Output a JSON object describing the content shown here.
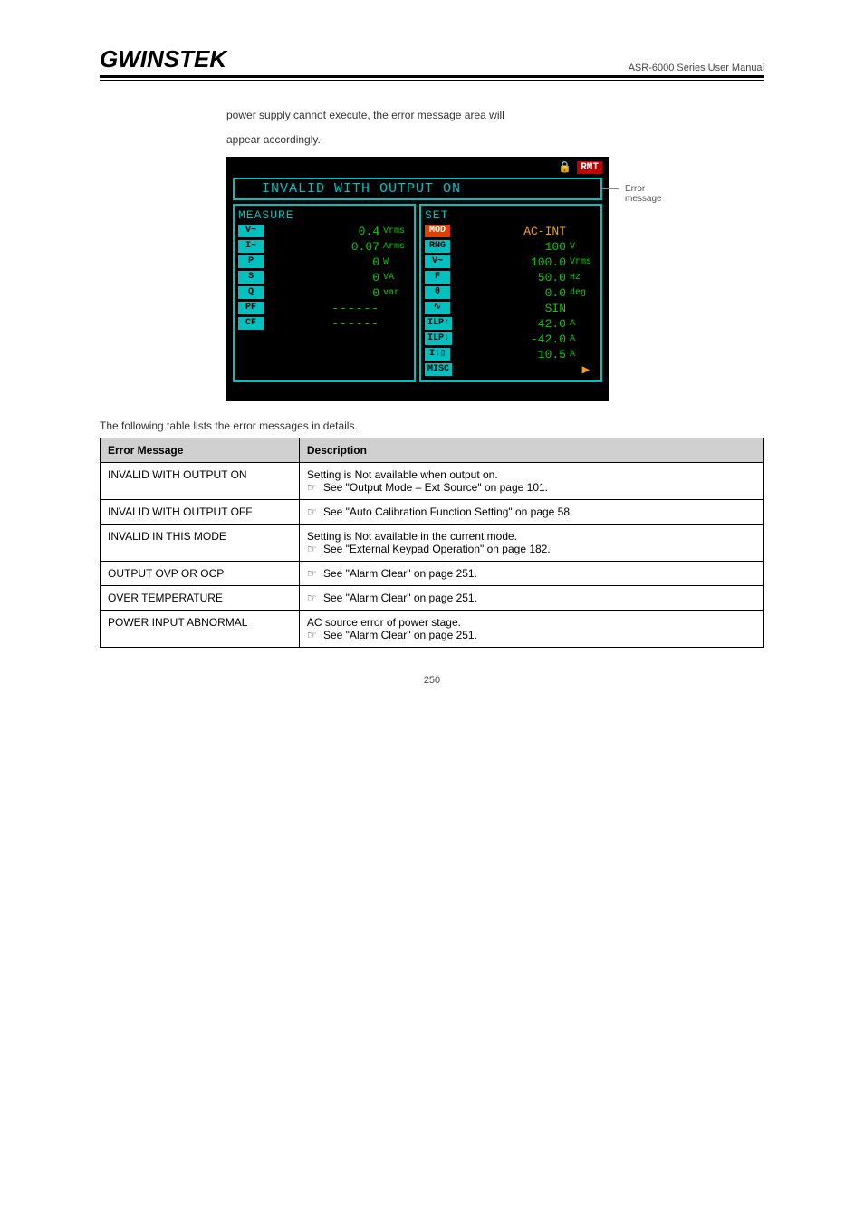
{
  "header": {
    "logo": "GWINSTEK",
    "right_title": "ASR-6000 Series User Manual"
  },
  "intro_line1": "power supply cannot execute, the error message area will",
  "intro_line2": "appear accordingly.",
  "lcd": {
    "rmt": "RMT",
    "msg": "INVALID WITH OUTPUT ON",
    "msg_label": "Error message",
    "measure_title": "MEASURE",
    "set_title": "SET",
    "measure": [
      {
        "badge": "V~",
        "val": "0.4",
        "unit": "Vrms"
      },
      {
        "badge": "I~",
        "val": "0.07",
        "unit": "Arms"
      },
      {
        "badge": "P",
        "val": "0",
        "unit": "W"
      },
      {
        "badge": "S",
        "val": "0",
        "unit": "VA"
      },
      {
        "badge": "Q",
        "val": "0",
        "unit": "var"
      },
      {
        "badge": "PF",
        "val": "------",
        "unit": ""
      },
      {
        "badge": "CF",
        "val": "------",
        "unit": ""
      }
    ],
    "set": [
      {
        "badge": "MOD",
        "sel": true,
        "val": "AC-INT",
        "unit": "",
        "orange": true
      },
      {
        "badge": "RNG",
        "sel": false,
        "val": "100",
        "unit": "V"
      },
      {
        "badge": "V~",
        "sel": false,
        "val": "100.0",
        "unit": "Vrms"
      },
      {
        "badge": "F",
        "sel": false,
        "val": "50.0",
        "unit": "Hz"
      },
      {
        "badge": "θ",
        "sel": false,
        "val": "0.0",
        "unit": "deg"
      },
      {
        "badge": "∿",
        "sel": false,
        "val": "SIN",
        "unit": ""
      },
      {
        "badge": "ILP↑",
        "sel": false,
        "val": "42.0",
        "unit": "A"
      },
      {
        "badge": "ILP↓",
        "sel": false,
        "val": "-42.0",
        "unit": "A"
      },
      {
        "badge": "I↓▯",
        "sel": false,
        "val": "10.5",
        "unit": "A"
      },
      {
        "badge": "MISC",
        "sel": false,
        "val": "▶",
        "unit": "",
        "arrow": true
      }
    ]
  },
  "table_caption": "The following table lists the error messages in details.",
  "table": {
    "head": [
      "Error Message",
      "Description"
    ],
    "rows": [
      {
        "msg": "INVALID WITH OUTPUT ON",
        "desc_lines": [
          "Setting is Not available when output on.",
          {
            "see": "Output Mode – Ext Source",
            "page": "101"
          }
        ]
      },
      {
        "msg": "INVALID WITH OUTPUT OFF",
        "desc_lines": [
          {
            "see": "Auto Calibration Function Setting",
            "page": "58"
          }
        ]
      },
      {
        "msg": "INVALID IN THIS MODE",
        "desc_lines": [
          "Setting is Not available in the current mode.",
          {
            "see": "External Keypad Operation",
            "page": "182"
          }
        ]
      },
      {
        "msg": "OUTPUT OVP OR OCP",
        "desc_lines": [
          {
            "see": "Alarm Clear",
            "page": "251"
          }
        ]
      },
      {
        "msg": "OVER TEMPERATURE",
        "desc_lines": [
          {
            "see": "Alarm Clear",
            "page": "251"
          }
        ]
      },
      {
        "msg": "POWER INPUT ABNORMAL",
        "desc_lines": [
          "AC source error of power stage.",
          {
            "see": "Alarm Clear",
            "page": "251"
          }
        ]
      }
    ]
  },
  "page_no": "250"
}
